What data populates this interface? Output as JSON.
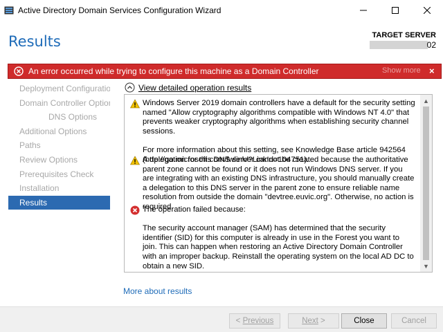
{
  "window": {
    "title": "Active Directory Domain Services Configuration Wizard",
    "minimize_label": "—",
    "maximize_label": "☐",
    "close_label": "✕"
  },
  "header": {
    "page_title": "Results",
    "target_server_label": "TARGET SERVER",
    "target_server_suffix": "02"
  },
  "error_banner": {
    "message": "An error occurred while trying to configure this machine as a Domain Controller",
    "show_more": "Show more",
    "close_label": "×",
    "color": "#cf2b2b"
  },
  "sidebar": {
    "items": [
      {
        "label": "Deployment Configuration"
      },
      {
        "label": "Domain Controller Options"
      },
      {
        "label": "DNS Options"
      },
      {
        "label": "Additional Options"
      },
      {
        "label": "Paths"
      },
      {
        "label": "Review Options"
      },
      {
        "label": "Prerequisites Check"
      },
      {
        "label": "Installation"
      },
      {
        "label": "Results"
      }
    ],
    "active_color": "#2c6ab1"
  },
  "main": {
    "details_toggle_label": "View detailed operation results",
    "messages": [
      {
        "icon": "warning-icon",
        "text": "Windows Server 2019 domain controllers have a default for the security setting named \"Allow cryptography algorithms compatible with Windows NT 4.0\" that prevents weaker cryptography algorithms when establishing security channel sessions.\n\nFor more information about this setting, see Knowledge Base article 942564 (http://go.microsoft.com/fwlink/?LinkId=104751)."
      },
      {
        "icon": "warning-icon",
        "text": "A delegation for this DNS server cannot be created because the authoritative parent zone cannot be found or it does not run Windows DNS server. If you are integrating with an existing DNS infrastructure, you should manually create a delegation to this DNS server in the parent zone to ensure reliable name resolution from outside the domain \"devtree.euvic.org\". Otherwise, no action is required."
      },
      {
        "icon": "error-icon",
        "text": "The operation failed because:\n\nThe security account manager (SAM) has determined that the security identifier (SID) for this computer is already in use in the Forest you want to join. This can happen when restoring an Active Directory Domain Controller with an improper backup. Reinstall the operating system on the local AD DC to obtain a new SID."
      }
    ],
    "more_link": "More about results"
  },
  "footer": {
    "previous_label": "Previous",
    "next_label": "Next",
    "close_label": "Close",
    "cancel_label": "Cancel",
    "previous_prefix": "< ",
    "next_suffix": " >"
  }
}
